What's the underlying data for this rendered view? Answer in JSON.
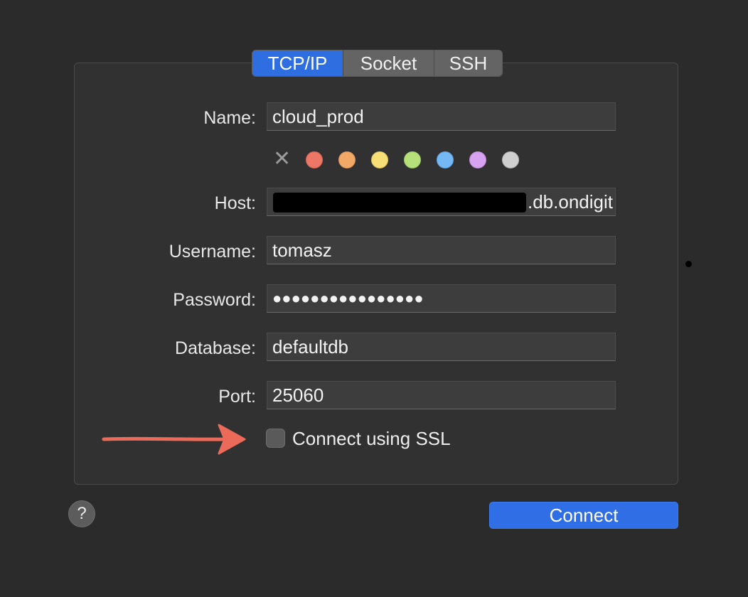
{
  "tabs": [
    {
      "label": "TCP/IP",
      "active": true
    },
    {
      "label": "Socket",
      "active": false
    },
    {
      "label": "SSH",
      "active": false
    }
  ],
  "form": {
    "name_label": "Name:",
    "name_value": "cloud_prod",
    "host_label": "Host:",
    "host_value_visible": ".db.ondigit",
    "host_value_redacted": true,
    "username_label": "Username:",
    "username_value": "tomasz",
    "password_label": "Password:",
    "password_value": "●●●●●●●●●●●●●●●●",
    "database_label": "Database:",
    "database_value": "defaultdb",
    "port_label": "Port:",
    "port_value": "25060"
  },
  "colors": {
    "clear_icon": "x-icon",
    "swatches": [
      "#ec7766",
      "#f2a967",
      "#f7de75",
      "#b6e07a",
      "#74b8f4",
      "#d7a3f0",
      "#cfcfcf"
    ]
  },
  "ssl": {
    "label": "Connect using SSL",
    "checked": false
  },
  "footer": {
    "help_label": "?",
    "connect_label": "Connect"
  },
  "theme": {
    "accent": "#2f6ee4",
    "annotation_arrow": "#ec6a5a"
  }
}
